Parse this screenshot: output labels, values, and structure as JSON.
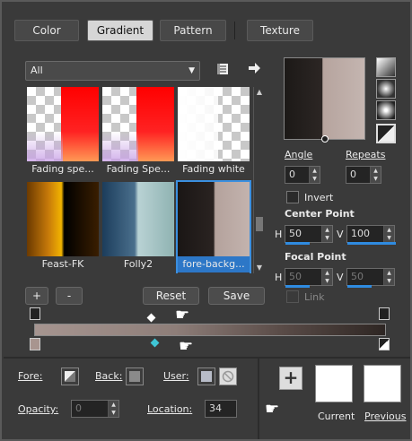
{
  "tabs": [
    {
      "label": "Color",
      "active": false
    },
    {
      "label": "Gradient",
      "active": true
    },
    {
      "label": "Pattern",
      "active": false
    },
    {
      "label": "Texture",
      "active": false
    }
  ],
  "category_dropdown": {
    "value": "All"
  },
  "icons": {
    "library": "library-icon",
    "arrow": "arrow-right-icon",
    "pointer": "pointing-hand-icon"
  },
  "gradients": [
    {
      "label": "Fading spe...",
      "selected": false
    },
    {
      "label": "Fading Spe...",
      "selected": false
    },
    {
      "label": "Fading white",
      "selected": false
    },
    {
      "label": "Feast-FK",
      "selected": false
    },
    {
      "label": "Folly2",
      "selected": false
    },
    {
      "label": "fore-backg...",
      "selected": true
    }
  ],
  "buttons": {
    "add": "+",
    "remove": "-",
    "reset": "Reset",
    "save": "Save"
  },
  "angle": {
    "label": "Angle",
    "value": "0"
  },
  "repeats": {
    "label": "Repeats",
    "value": "0"
  },
  "invert": {
    "label": "Invert",
    "checked": false
  },
  "center_point": {
    "label": "Center Point",
    "h_label": "H",
    "h_value": "50",
    "v_label": "V",
    "v_value": "100"
  },
  "focal_point": {
    "label": "Focal Point",
    "h_label": "H",
    "h_value": "50",
    "v_label": "V",
    "v_value": "50"
  },
  "link": {
    "label": "Link",
    "checked": false
  },
  "stop_colors": {
    "fore": "#3a2f2b",
    "back": "#a8958f",
    "accent": "#3fc6d6",
    "bar_left": "#a69590",
    "bar_right": "#2e2623"
  },
  "bottom": {
    "fore_label": "Fore:",
    "back_label": "Back:",
    "user_label": "User:",
    "opacity_label": "Opacity:",
    "opacity_value": "0",
    "location_label": "Location:",
    "location_value": "34",
    "current_label": "Current",
    "previous_label": "Previous"
  }
}
